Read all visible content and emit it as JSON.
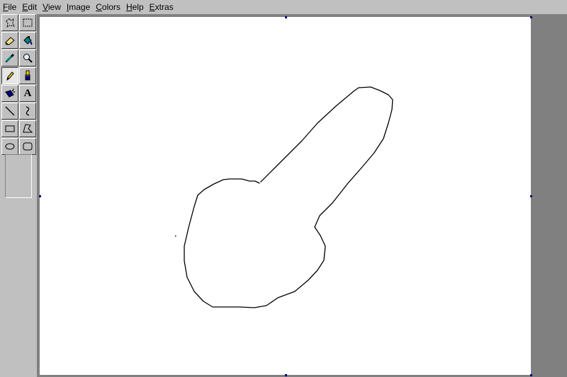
{
  "menu": {
    "file": {
      "hot": "F",
      "rest": "ile"
    },
    "edit": {
      "hot": "E",
      "rest": "dit"
    },
    "view": {
      "hot": "V",
      "rest": "iew"
    },
    "image": {
      "hot": "I",
      "rest": "mage"
    },
    "colors": {
      "hot": "C",
      "rest": "olors"
    },
    "help": {
      "hot": "H",
      "rest": "elp"
    },
    "extras": {
      "hot": "E",
      "rest": "xtras"
    }
  },
  "tools": [
    {
      "name": "free-form-select-icon"
    },
    {
      "name": "rect-select-icon"
    },
    {
      "name": "eraser-icon"
    },
    {
      "name": "fill-bucket-icon"
    },
    {
      "name": "color-picker-icon"
    },
    {
      "name": "magnifier-icon"
    },
    {
      "name": "pencil-icon",
      "active": true
    },
    {
      "name": "brush-icon"
    },
    {
      "name": "airbrush-icon"
    },
    {
      "name": "text-icon",
      "glyph": "A"
    },
    {
      "name": "line-icon"
    },
    {
      "name": "curve-icon"
    },
    {
      "name": "rectangle-icon"
    },
    {
      "name": "polygon-icon"
    },
    {
      "name": "ellipse-icon"
    },
    {
      "name": "rounded-rect-icon"
    }
  ],
  "colors": {
    "chrome": "#c0c0c0",
    "workspace": "#808080",
    "canvas": "#ffffff",
    "stroke": "#000000",
    "handle": "#000080"
  }
}
